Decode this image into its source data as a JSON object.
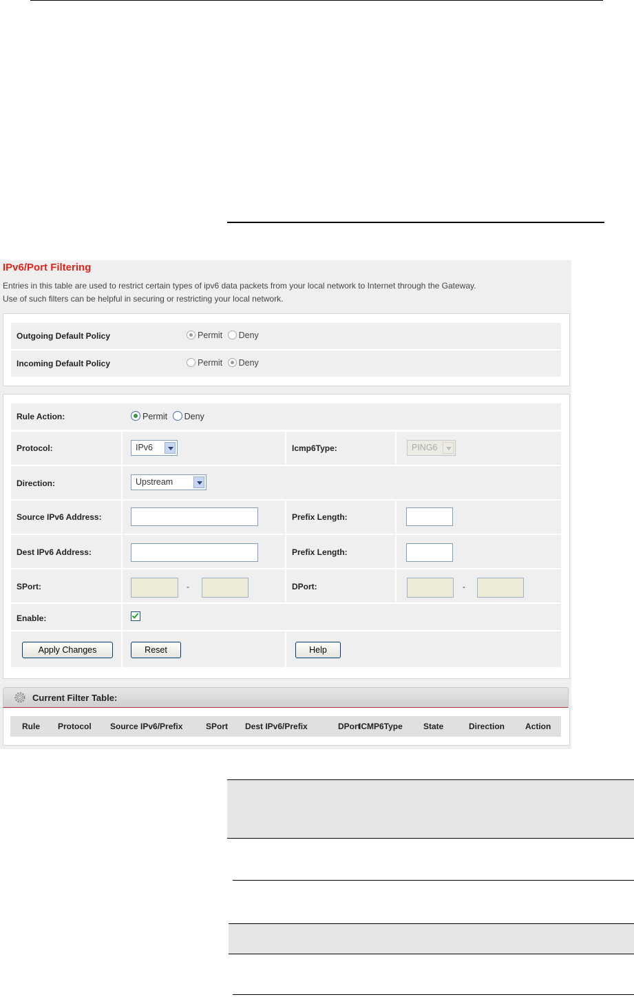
{
  "page": {
    "title": "IPv6/Port Filtering",
    "description_line1": "Entries in this table are used to restrict certain types of ipv6 data packets from your local network to Internet through the Gateway.",
    "description_line2": "Use of such filters can be helpful in securing or restricting your local network."
  },
  "policy": {
    "outgoing_label": "Outgoing Default Policy",
    "incoming_label": "Incoming Default Policy",
    "permit_label": "Permit",
    "deny_label": "Deny",
    "outgoing_selected": "Permit",
    "incoming_selected": "Deny"
  },
  "form": {
    "rule_action_label": "Rule Action:",
    "rule_action_permit": "Permit",
    "rule_action_deny": "Deny",
    "rule_action_selected": "Permit",
    "protocol_label": "Protocol:",
    "protocol_value": "IPv6",
    "icmp6type_label": "Icmp6Type:",
    "icmp6type_value": "PING6",
    "direction_label": "Direction:",
    "direction_value": "Upstream",
    "source_label": "Source IPv6 Address:",
    "source_value": "",
    "prefix_label_1": "Prefix Length:",
    "prefix_value_1": "",
    "dest_label": "Dest IPv6 Address:",
    "dest_value": "",
    "prefix_label_2": "Prefix Length:",
    "prefix_value_2": "",
    "sport_label": "SPort:",
    "dport_label": "DPort:",
    "range_sep": "-",
    "enable_label": "Enable:",
    "enable_checked": true
  },
  "buttons": {
    "apply": "Apply Changes",
    "reset": "Reset",
    "help": "Help"
  },
  "table": {
    "title": "Current Filter Table:",
    "columns": [
      "Rule",
      "Protocol",
      "Source IPv6/Prefix",
      "SPort",
      "Dest IPv6/Prefix",
      "DPort",
      "ICMP6Type",
      "State",
      "Direction",
      "Action"
    ]
  }
}
